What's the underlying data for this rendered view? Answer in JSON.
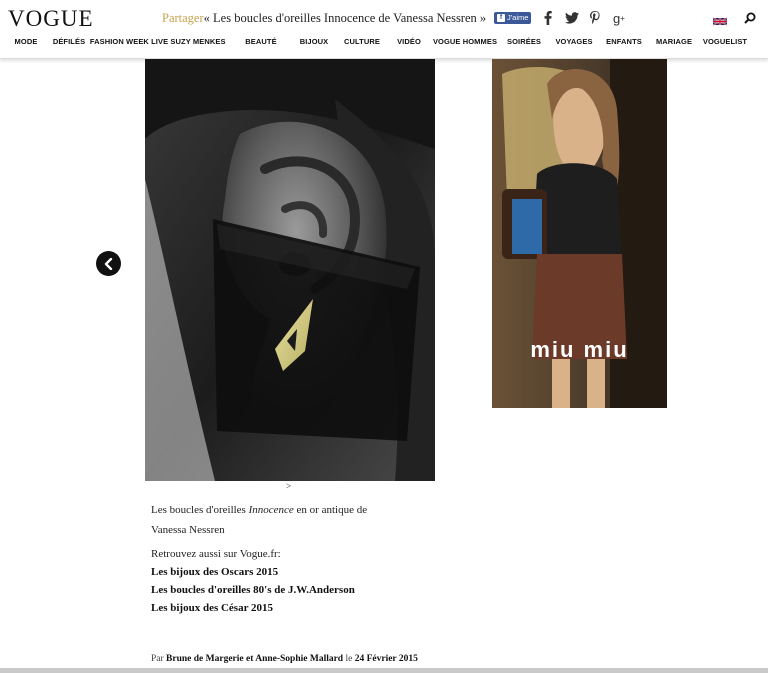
{
  "header": {
    "logo": "VOGUE",
    "share_prefix": "Partager",
    "share_title": "« Les boucles d'oreilles Innocence de Vanessa Nessren »",
    "fb_like": "J'aime"
  },
  "icons": {
    "facebook": "facebook-icon",
    "twitter": "twitter-icon",
    "pinterest": "pinterest-icon",
    "googleplus": "google-plus-icon",
    "language": "uk-flag-icon",
    "search": "search-icon"
  },
  "nav": {
    "items": [
      "MODE",
      "DÉFILÉS",
      "FASHION WEEK LIVE",
      "SUZY MENKES",
      "BEAUTÉ",
      "BIJOUX",
      "CULTURE",
      "VIDÉO",
      "VOGUE HOMMES",
      "SOIRÉES",
      "VOYAGES",
      "ENFANTS",
      "MARIAGE",
      "VOGUELIST"
    ]
  },
  "gallery": {
    "next_hint": ">"
  },
  "ad": {
    "brand": "miu miu"
  },
  "caption": {
    "before": "Les boucles d'oreilles ",
    "emph": "Innocence",
    "after": " en or antique de",
    "line2": "Vanessa Nessren"
  },
  "see_also": {
    "intro": "Retrouvez aussi sur Vogue.fr:",
    "links": [
      "Les bijoux des Oscars 2015",
      "Les boucles d'oreilles 80's de J.W.Anderson",
      "Les bijoux des César 2015"
    ]
  },
  "byline": {
    "prefix": "Par ",
    "authors": "Brune de Margerie et Anne-Sophie Mallard",
    "middle": " le ",
    "date": "24 Février 2015"
  }
}
